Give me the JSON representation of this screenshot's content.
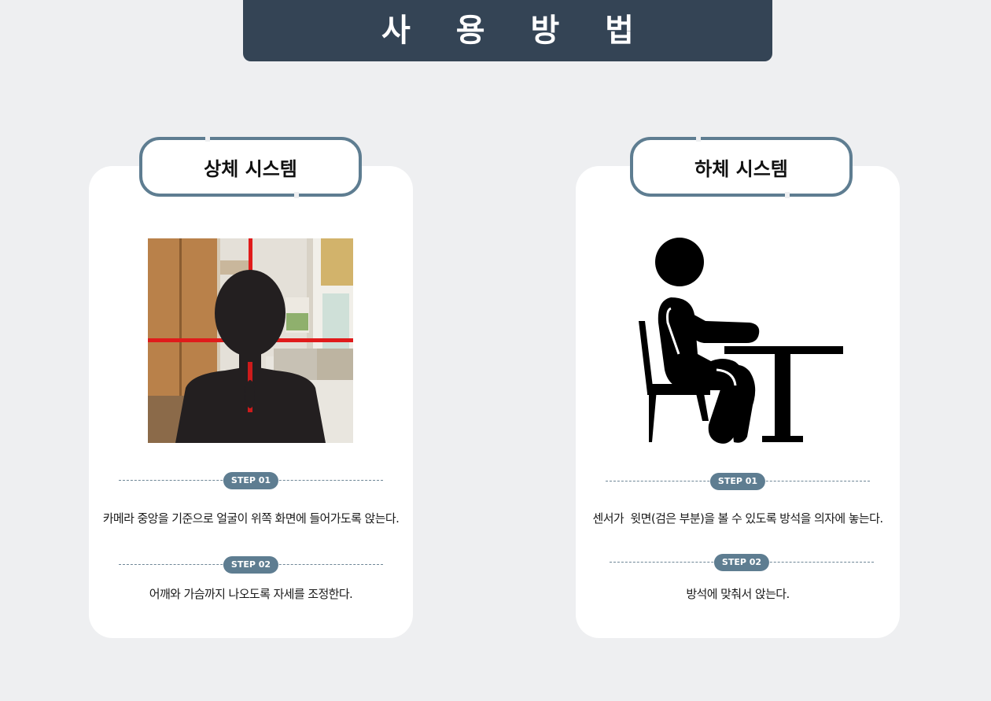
{
  "header": {
    "title": "사 용 방 법"
  },
  "colors": {
    "header_bg": "#344455",
    "accent": "#5e7d91",
    "background": "#eeeff1"
  },
  "left_panel": {
    "title": "상체 시스템",
    "image": "upper-body-silhouette-camera-crosshair",
    "steps": [
      {
        "label": "STEP 01",
        "text": "카메라 중앙을 기준으로 얼굴이 위쪽 화면에 들어가도록 앉는다."
      },
      {
        "label": "STEP 02",
        "text": "어깨와 가슴까지 나오도록 자세를 조정한다."
      }
    ]
  },
  "right_panel": {
    "title": "하체 시스템",
    "image": "person-sitting-at-desk-icon",
    "steps": [
      {
        "label": "STEP 01",
        "text": "센서가  윗면(검은 부분)을 볼 수 있도록 방석을 의자에 놓는다."
      },
      {
        "label": "STEP 02",
        "text": "방석에 맞춰서 앉는다."
      }
    ]
  }
}
